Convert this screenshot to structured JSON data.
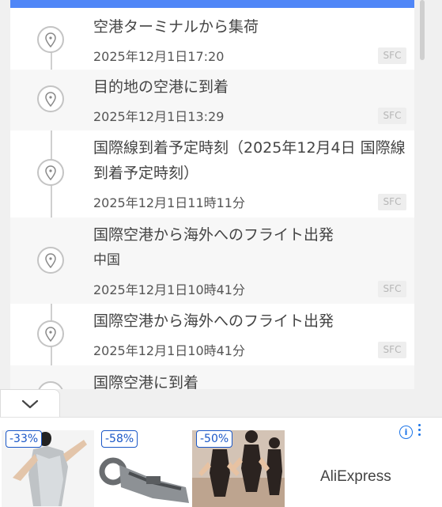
{
  "tracking": {
    "events": [
      {
        "title": "空港ターミナルから集荷",
        "time": "2025年12月1日17:20",
        "badge": "SFC"
      },
      {
        "title": "目的地の空港に到着",
        "time": "2025年12月1日13:29",
        "badge": "SFC"
      },
      {
        "title": "国際線到着予定時刻（2025年12月4日 国際線到着予定時刻）",
        "time": "2025年12月1日11時11分",
        "badge": "SFC"
      },
      {
        "title": "国際空港から海外へのフライト出発",
        "subtitle": "中国",
        "time": "2025年12月1日10時41分",
        "badge": "SFC"
      },
      {
        "title": "国際空港から海外へのフライト出発",
        "time": "2025年12月1日10時41分",
        "badge": "SFC"
      },
      {
        "title": "国際空港に到着"
      }
    ]
  },
  "ad": {
    "products": [
      {
        "discount": "-33%",
        "icon": "silver-dress-product-image"
      },
      {
        "discount": "-58%",
        "icon": "metal-part-product-image"
      },
      {
        "discount": "-50%",
        "icon": "dance-costume-product-image"
      }
    ],
    "brand": "AliExpress",
    "info_icon": "i"
  }
}
